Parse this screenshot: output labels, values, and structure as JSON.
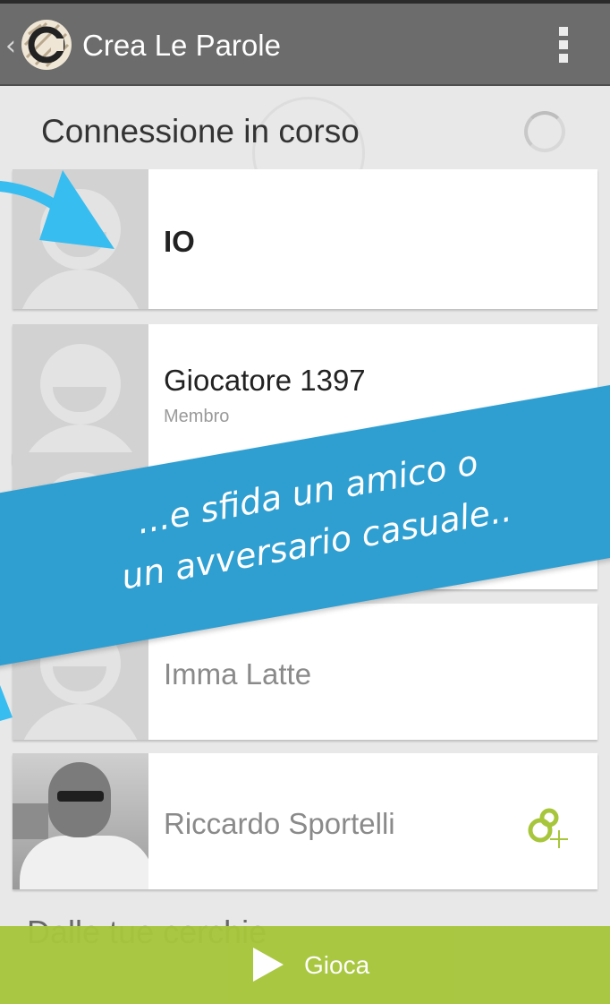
{
  "app": {
    "title": "Crea Le Parole",
    "logo_letter": "C"
  },
  "status": {
    "text": "Connessione in corso"
  },
  "players": [
    {
      "name": "IO",
      "subtitle": ""
    },
    {
      "name": "Giocatore 1397",
      "subtitle": "Membro"
    },
    {
      "name": "Imma Latte",
      "subtitle": ""
    },
    {
      "name": "Riccardo Sportelli",
      "subtitle": ""
    }
  ],
  "section": {
    "title": "Dalle tue cerchie"
  },
  "banner": {
    "line1": "...e sfida un amico o",
    "line2": "un avversario casuale.."
  },
  "play": {
    "label": "Gioca"
  },
  "colors": {
    "accent_blue": "#2f9fd2",
    "play_green": "#a7c63b",
    "action_bar": "#6c6c6c"
  }
}
